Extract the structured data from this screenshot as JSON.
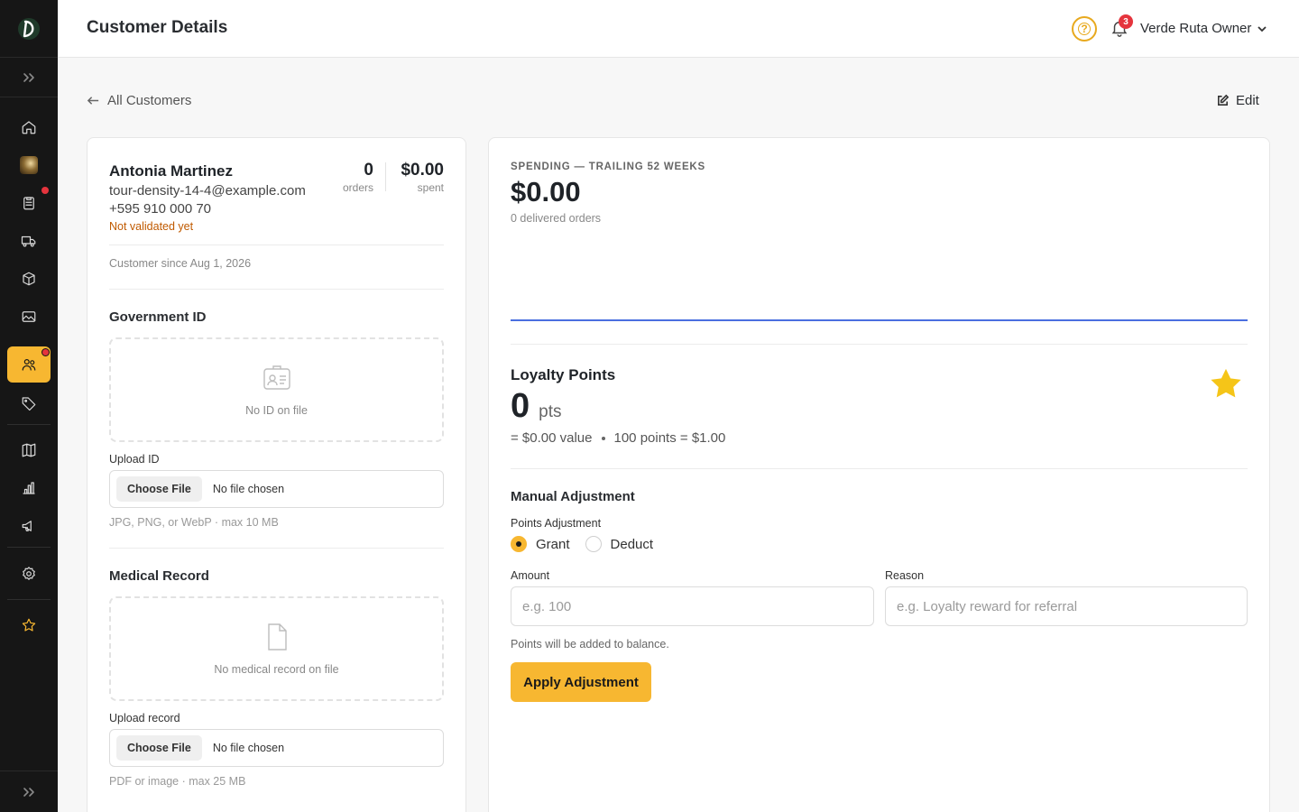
{
  "header": {
    "title": "Customer Details",
    "help_glyph": "?",
    "notification_count": "3",
    "user_name": "Verde Ruta Owner"
  },
  "nav": {
    "back_label": "All Customers",
    "edit_label": "Edit"
  },
  "sidebar": {
    "items": [
      {
        "name": "home",
        "icon": "home-icon"
      },
      {
        "name": "store",
        "icon": "store-avatar"
      },
      {
        "name": "orders",
        "icon": "clipboard-icon",
        "has_alert": true
      },
      {
        "name": "delivery",
        "icon": "truck-icon"
      },
      {
        "name": "products",
        "icon": "box-icon"
      },
      {
        "name": "media",
        "icon": "image-icon"
      },
      {
        "name": "customers",
        "icon": "users-icon",
        "active": true,
        "has_alert": true
      },
      {
        "name": "tags",
        "icon": "tag-icon"
      },
      {
        "name": "catalog",
        "icon": "book-icon"
      },
      {
        "name": "analytics",
        "icon": "bar-chart-icon"
      },
      {
        "name": "marketing",
        "icon": "megaphone-icon"
      },
      {
        "name": "settings",
        "icon": "gear-icon"
      },
      {
        "name": "loyalty",
        "icon": "star-icon"
      }
    ]
  },
  "customer": {
    "name": "Antonia Martinez",
    "email": "tour-density-14-4@example.com",
    "phone": "+595 910 000 70",
    "validation_status": "Not validated yet",
    "orders_value": "0",
    "orders_label": "orders",
    "spent_value": "$0.00",
    "spent_label": "spent",
    "since": "Customer since Aug 1, 2026"
  },
  "government_id": {
    "title": "Government ID",
    "empty_text": "No ID on file",
    "upload_label": "Upload ID",
    "choose_button": "Choose File",
    "file_status": "No file chosen",
    "hint": "JPG, PNG, or WebP · max 10 MB"
  },
  "medical_record": {
    "title": "Medical Record",
    "empty_text": "No medical record on file",
    "upload_label": "Upload record",
    "choose_button": "Choose File",
    "file_status": "No file chosen",
    "hint": "PDF or image · max 25 MB"
  },
  "spending": {
    "caption": "SPENDING — TRAILING 52 WEEKS",
    "total": "$0.00",
    "subtitle": "0 delivered orders"
  },
  "chart_data": {
    "type": "line",
    "title": "",
    "series": [
      {
        "values": [
          0,
          0
        ]
      }
    ],
    "line_color": "#4a6fe0"
  },
  "loyalty": {
    "title": "Loyalty Points",
    "points": "0",
    "unit": "pts",
    "value_text": "= $0.00 value",
    "rate_text": "100 points = $1.00",
    "star_color": "#f5c518"
  },
  "adjustment": {
    "title": "Manual Adjustment",
    "type_label": "Points Adjustment",
    "grant_label": "Grant",
    "deduct_label": "Deduct",
    "selected": "Grant",
    "amount_label": "Amount",
    "amount_placeholder": "e.g. 100",
    "reason_label": "Reason",
    "reason_placeholder": "e.g. Loyalty reward for referral",
    "hint": "Points will be added to balance.",
    "apply_label": "Apply Adjustment"
  },
  "colors": {
    "accent": "#f7b731",
    "sidebar_bg": "#161616",
    "alert": "#e5343d",
    "warning_text": "#c05a00"
  }
}
